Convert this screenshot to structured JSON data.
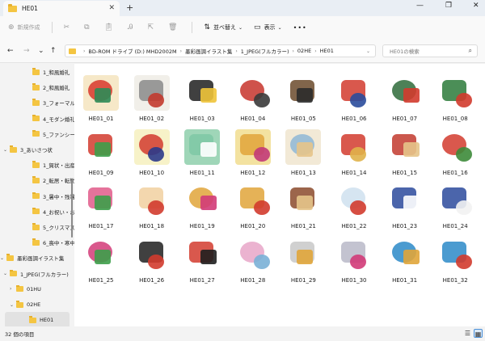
{
  "window": {
    "tab_title": "HE01",
    "tab_close": "✕",
    "new_tab": "+",
    "minimize": "—",
    "maximize": "❐",
    "close": "✕"
  },
  "commands": {
    "new": "新規作成",
    "sort": "並べ替え",
    "view": "表示",
    "more": "•••"
  },
  "address": {
    "crumbs": [
      "BD-ROM ドライブ (D:) MHD2002M",
      "墨彩画調イラスト集",
      "1_JPEG(フルカラー)",
      "02HE",
      "HE01"
    ],
    "search_placeholder": "HE01の検索"
  },
  "sidebar": {
    "items": [
      {
        "label": "1_和風婚礼",
        "arrow": ""
      },
      {
        "label": "2_和風婚礼",
        "arrow": ""
      },
      {
        "label": "3_フォーマル婚礼",
        "arrow": ""
      },
      {
        "label": "4_モダン婚礼",
        "arrow": ""
      },
      {
        "label": "5_ファンシー婚礼",
        "arrow": ""
      },
      {
        "label": "3_あいさつ状",
        "arrow": "⌄"
      },
      {
        "label": "1_賀状・出産",
        "arrow": ""
      },
      {
        "label": "2_転居・転勤",
        "arrow": ""
      },
      {
        "label": "3_暑中・残暑",
        "arrow": ""
      },
      {
        "label": "4_お祝い・お礼",
        "arrow": ""
      },
      {
        "label": "5_クリスマス・",
        "arrow": ""
      },
      {
        "label": "6_喪中・寒中",
        "arrow": ""
      },
      {
        "label": "墨彩画調イラスト集",
        "arrow": "⌄"
      },
      {
        "label": "1_JPEG(フルカラー)",
        "arrow": "⌄"
      },
      {
        "label": "01HU",
        "arrow": "›"
      },
      {
        "label": "02HE",
        "arrow": "⌄"
      },
      {
        "label": "HE01",
        "arrow": ""
      }
    ]
  },
  "files": [
    {
      "name": "HE01_01",
      "c1": "#d8372c",
      "c2": "#2e8b57",
      "bg": "#f6e8c8"
    },
    {
      "name": "HE01_02",
      "c1": "#8a8a8a",
      "c2": "#c23a2e",
      "bg": "#f1efe9"
    },
    {
      "name": "HE01_03",
      "c1": "#1f1f1f",
      "c2": "#f0c43a",
      "bg": "#ffffff"
    },
    {
      "name": "HE01_04",
      "c1": "#c7342b",
      "c2": "#3a3a3a",
      "bg": "#ffffff"
    },
    {
      "name": "HE01_05",
      "c1": "#6b4a2b",
      "c2": "#2b2b2b",
      "bg": "#ffffff"
    },
    {
      "name": "HE01_06",
      "c1": "#d23b2e",
      "c2": "#2a4d9c",
      "bg": "#ffffff"
    },
    {
      "name": "HE01_07",
      "c1": "#2e6b3a",
      "c2": "#d23b2e",
      "bg": "#ffffff"
    },
    {
      "name": "HE01_08",
      "c1": "#2c7a3a",
      "c2": "#d23b2e",
      "bg": "#ffffff"
    },
    {
      "name": "HE01_09",
      "c1": "#d23b2e",
      "c2": "#3d9f4a",
      "bg": "#ffffff"
    },
    {
      "name": "HE01_10",
      "c1": "#d23b2e",
      "c2": "#2b3a8a",
      "bg": "#f7f2c8"
    },
    {
      "name": "HE01_11",
      "c1": "#7ec8a4",
      "c2": "#ffffff",
      "bg": "#9fd6b8"
    },
    {
      "name": "HE01_12",
      "c1": "#e0a53a",
      "c2": "#c23a78",
      "bg": "#f3e2a0"
    },
    {
      "name": "HE01_13",
      "c1": "#8fb7d6",
      "c2": "#e6c48a",
      "bg": "#f2e9d6"
    },
    {
      "name": "HE01_14",
      "c1": "#d23b2e",
      "c2": "#e0b34a",
      "bg": "#ffffff"
    },
    {
      "name": "HE01_15",
      "c1": "#c23a2e",
      "c2": "#e6c48a",
      "bg": "#ffffff"
    },
    {
      "name": "HE01_16",
      "c1": "#d23b2e",
      "c2": "#3d8b3a",
      "bg": "#ffffff"
    },
    {
      "name": "HE01_17",
      "c1": "#e05a8a",
      "c2": "#3d9f4a",
      "bg": "#ffffff"
    },
    {
      "name": "HE01_18",
      "c1": "#f1d0a0",
      "c2": "#d23b2e",
      "bg": "#ffffff"
    },
    {
      "name": "HE01_19",
      "c1": "#e0a53a",
      "c2": "#d23b78",
      "bg": "#ffffff"
    },
    {
      "name": "HE01_20",
      "c1": "#e0a53a",
      "c2": "#d23b2e",
      "bg": "#ffffff"
    },
    {
      "name": "HE01_21",
      "c1": "#8b4a2b",
      "c2": "#e6c48a",
      "bg": "#ffffff"
    },
    {
      "name": "HE01_22",
      "c1": "#cfe0ef",
      "c2": "#d23b2e",
      "bg": "#ffffff"
    },
    {
      "name": "HE01_23",
      "c1": "#2b4a9c",
      "c2": "#ffffff",
      "bg": "#ffffff"
    },
    {
      "name": "HE01_24",
      "c1": "#2b4a9c",
      "c2": "#f2f2f2",
      "bg": "#ffffff"
    },
    {
      "name": "HE01_25",
      "c1": "#d23b78",
      "c2": "#3d9f4a",
      "bg": "#ffffff"
    },
    {
      "name": "HE01_26",
      "c1": "#1f1f1f",
      "c2": "#d23b2e",
      "bg": "#ffffff"
    },
    {
      "name": "HE01_27",
      "c1": "#d23b2e",
      "c2": "#1f1f1f",
      "bg": "#ffffff"
    },
    {
      "name": "HE01_28",
      "c1": "#e7a6c8",
      "c2": "#7ab0d6",
      "bg": "#ffffff"
    },
    {
      "name": "HE01_29",
      "c1": "#c8c8c8",
      "c2": "#e0a53a",
      "bg": "#ffffff"
    },
    {
      "name": "HE01_30",
      "c1": "#b8b8c8",
      "c2": "#d23b78",
      "bg": "#ffffff"
    },
    {
      "name": "HE01_31",
      "c1": "#2b8ac8",
      "c2": "#e0a53a",
      "bg": "#ffffff"
    },
    {
      "name": "HE01_32",
      "c1": "#2b8ac8",
      "c2": "#d23b2e",
      "bg": "#ffffff"
    }
  ],
  "status": {
    "count": "32 個の項目"
  }
}
